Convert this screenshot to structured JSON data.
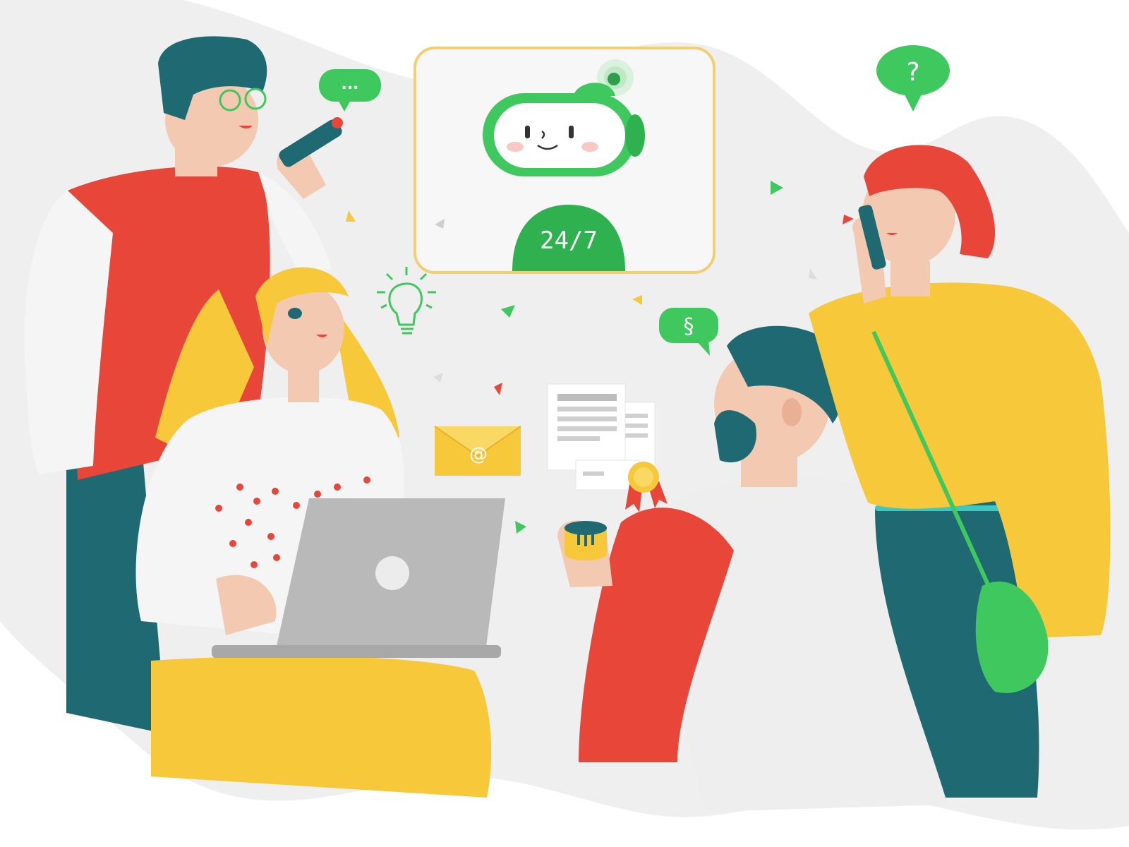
{
  "scene": {
    "kind": "flat illustration",
    "colors": {
      "background": "#ffffff",
      "blob": "#efefef",
      "green": "#3fc85e",
      "green_dark": "#22a845",
      "red": "#e9463a",
      "yellow": "#f6c83a",
      "teal": "#1f6a72",
      "skin": "#f3c9b2",
      "grey": "#b9b9b9",
      "frame_border": "#f3cf72"
    }
  },
  "robot_card": {
    "badge_text": "24/7",
    "icon": "chatbot-robot-icon"
  },
  "speech_bubbles": {
    "typing_text": "...",
    "question_text": "?",
    "section_text": "§"
  },
  "icons": {
    "email_symbol": "@",
    "envelope": "email-envelope-icon",
    "lightbulb": "lightbulb-icon",
    "document": "document-icon",
    "certificate": "certificate-seal-icon",
    "laptop": "laptop-icon",
    "phone": "phone-icon",
    "smart_speaker": "smart-speaker-icon"
  },
  "people": [
    {
      "name": "man-with-glasses-on-phone"
    },
    {
      "name": "blonde-woman-with-laptop"
    },
    {
      "name": "bearded-man-with-speaker"
    },
    {
      "name": "redhead-woman-on-phone"
    }
  ]
}
